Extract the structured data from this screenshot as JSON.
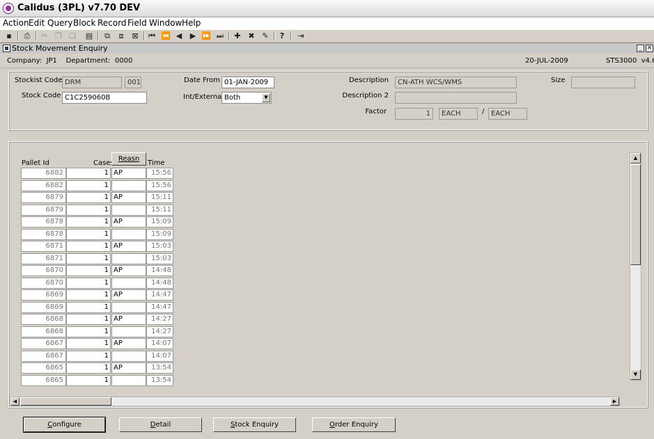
{
  "app": {
    "title": "Calidus (3PL) v7.70 DEV"
  },
  "menu": [
    "Action",
    "Edit",
    "Query",
    "Block",
    "Record",
    "Field",
    "Window",
    "Help"
  ],
  "toolbar": [
    {
      "name": "save-icon",
      "glyph": "▪"
    },
    {
      "name": "print-icon",
      "glyph": "⎙"
    },
    {
      "name": "cut-icon",
      "glyph": "✂"
    },
    {
      "name": "copy-icon",
      "glyph": "❐"
    },
    {
      "name": "paste-icon",
      "glyph": "❏"
    },
    {
      "name": "list-icon",
      "glyph": "▤"
    },
    {
      "name": "query-icon",
      "glyph": "⧉"
    },
    {
      "name": "execute-query-icon",
      "glyph": "⧈"
    },
    {
      "name": "cancel-query-icon",
      "glyph": "⊠"
    },
    {
      "name": "first-record-icon",
      "glyph": "⏮"
    },
    {
      "name": "prev-block-icon",
      "glyph": "⏪"
    },
    {
      "name": "prev-record-icon",
      "glyph": "◀"
    },
    {
      "name": "next-record-icon",
      "glyph": "▶"
    },
    {
      "name": "next-block-icon",
      "glyph": "⏩"
    },
    {
      "name": "last-record-icon",
      "glyph": "⏭"
    },
    {
      "name": "insert-record-icon",
      "glyph": "✚"
    },
    {
      "name": "delete-record-icon",
      "glyph": "✖"
    },
    {
      "name": "clear-record-icon",
      "glyph": "✎"
    },
    {
      "name": "help-icon",
      "glyph": "?"
    },
    {
      "name": "exit-icon",
      "glyph": "⇥"
    }
  ],
  "form": {
    "title": "Stock Movement Enquiry",
    "minimize": "_",
    "close": "×"
  },
  "company_bar": {
    "company": "Company:  JP1    Department:  0000",
    "date": "20-JUL-2009",
    "code": "STS3000  v4.6"
  },
  "header": {
    "stockist_code_label": "Stockist Code",
    "stockist_code": "DRM",
    "stockist_sub": "001",
    "stock_code_label": "Stock Code",
    "stock_code": "C1C259060B",
    "date_from_label": "Date From",
    "date_from": "01-JAN-2009",
    "int_external_label": "Int/External",
    "int_external": "Both",
    "description_label": "Description",
    "description": "CN-ATH WCS/WMS",
    "description2_label": "Description 2",
    "description2": "",
    "factor_label": "Factor",
    "factor_value": "1",
    "factor_unit1": "EACH",
    "factor_separator": "/",
    "factor_unit2": "EACH",
    "size_label": "Size",
    "size": ""
  },
  "grid": {
    "headers": {
      "pallet_id": "Pallet Id",
      "cases": "Cases",
      "reason": "Reasn",
      "time": "Time"
    },
    "rows": [
      {
        "pallet_id": "6882",
        "cases": "1",
        "reason": "AP",
        "time": "15:56"
      },
      {
        "pallet_id": "6882",
        "cases": "1",
        "reason": "",
        "time": "15:56"
      },
      {
        "pallet_id": "6879",
        "cases": "1",
        "reason": "AP",
        "time": "15:11"
      },
      {
        "pallet_id": "6879",
        "cases": "1",
        "reason": "",
        "time": "15:11"
      },
      {
        "pallet_id": "6878",
        "cases": "1",
        "reason": "AP",
        "time": "15:09"
      },
      {
        "pallet_id": "6878",
        "cases": "1",
        "reason": "",
        "time": "15:09"
      },
      {
        "pallet_id": "6871",
        "cases": "1",
        "reason": "AP",
        "time": "15:03"
      },
      {
        "pallet_id": "6871",
        "cases": "1",
        "reason": "",
        "time": "15:03"
      },
      {
        "pallet_id": "6870",
        "cases": "1",
        "reason": "AP",
        "time": "14:48"
      },
      {
        "pallet_id": "6870",
        "cases": "1",
        "reason": "",
        "time": "14:48"
      },
      {
        "pallet_id": "6869",
        "cases": "1",
        "reason": "AP",
        "time": "14:47"
      },
      {
        "pallet_id": "6869",
        "cases": "1",
        "reason": "",
        "time": "14:47"
      },
      {
        "pallet_id": "6868",
        "cases": "1",
        "reason": "AP",
        "time": "14:27"
      },
      {
        "pallet_id": "6868",
        "cases": "1",
        "reason": "",
        "time": "14:27"
      },
      {
        "pallet_id": "6867",
        "cases": "1",
        "reason": "AP",
        "time": "14:07"
      },
      {
        "pallet_id": "6867",
        "cases": "1",
        "reason": "",
        "time": "14:07"
      },
      {
        "pallet_id": "6865",
        "cases": "1",
        "reason": "AP",
        "time": "13:54"
      },
      {
        "pallet_id": "6865",
        "cases": "1",
        "reason": "",
        "time": "13:54"
      }
    ]
  },
  "scroll": {
    "up": "▲",
    "down": "▼",
    "left": "◀",
    "right": "▶"
  },
  "buttons": {
    "configure_u": "C",
    "configure_rest": "onfigure",
    "detail_u": "D",
    "detail_rest": "etail",
    "stock_enquiry_u": "S",
    "stock_enquiry_rest": "tock Enquiry",
    "order_enquiry_u": "O",
    "order_enquiry_rest": "rder Enquiry"
  }
}
